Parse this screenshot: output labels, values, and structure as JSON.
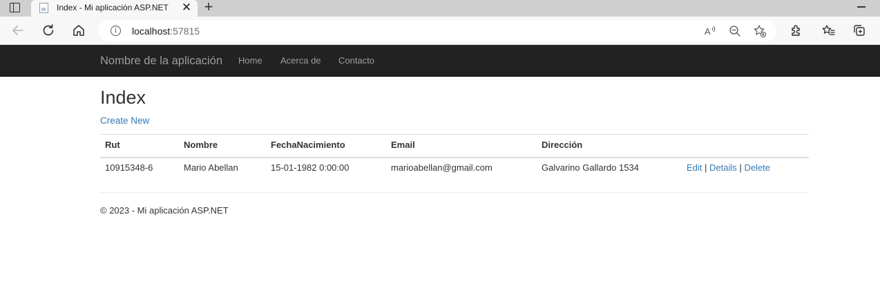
{
  "browser": {
    "tab_title": "Index - Mi aplicación ASP.NET",
    "url_host": "localhost",
    "url_port": ":57815",
    "icons": [
      "window-icon",
      "page-favicon-icon",
      "close-icon",
      "plus-icon",
      "minimize-icon",
      "back-arrow-icon",
      "refresh-icon",
      "home-icon",
      "info-icon",
      "read-aloud-icon",
      "zoom-out-icon",
      "add-favorite-icon",
      "extensions-icon",
      "favorites-icon",
      "collections-icon"
    ]
  },
  "navbar": {
    "brand": "Nombre de la aplicación",
    "links": [
      "Home",
      "Acerca de",
      "Contacto"
    ]
  },
  "main": {
    "title": "Index",
    "create_link": "Create New",
    "table": {
      "headers": [
        "Rut",
        "Nombre",
        "FechaNacimiento",
        "Email",
        "Dirección"
      ],
      "rows": [
        [
          "10915348-6",
          "Mario Abellan",
          "15-01-1982 0:00:00",
          "marioabellan@gmail.com",
          "Galvarino Gallardo 1534"
        ]
      ],
      "actions": [
        "Edit",
        "Details",
        "Delete"
      ],
      "action_separator": "|"
    }
  },
  "footer": {
    "text": "© 2023 - Mi aplicación ASP.NET"
  },
  "colors": {
    "navbar_bg": "#222222",
    "navbar_text": "#9d9d9d",
    "link": "#337ab7",
    "text": "#333333"
  }
}
